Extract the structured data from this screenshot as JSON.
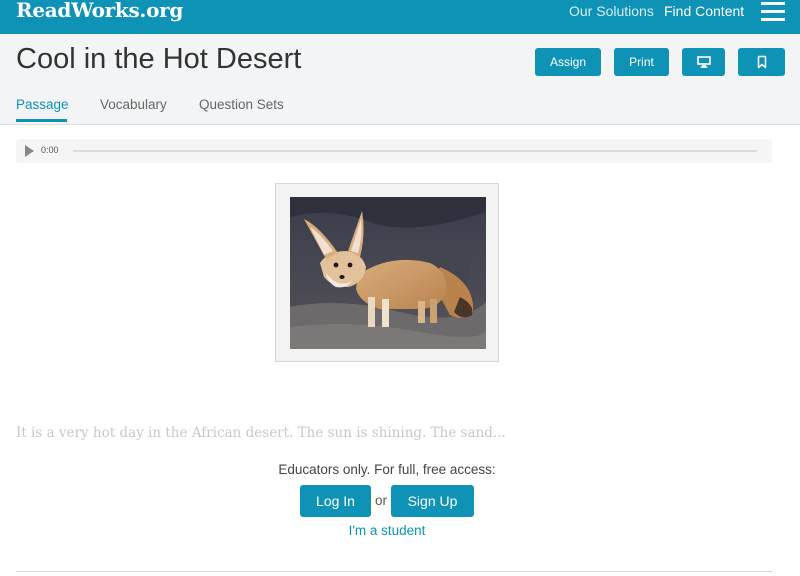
{
  "nav": {
    "logo": "ReadWorks.org",
    "our_solutions": "Our Solutions",
    "find_content": "Find Content",
    "menu_icon": "hamburger-icon"
  },
  "header": {
    "title": "Cool in the Hot Desert",
    "assign_label": "Assign",
    "print_label": "Print",
    "monitor_icon": "monitor-icon",
    "bookmark_icon": "bookmark-icon",
    "tabs": [
      {
        "label": "Passage",
        "active": true
      },
      {
        "label": "Vocabulary",
        "active": false
      },
      {
        "label": "Question Sets",
        "active": false
      }
    ]
  },
  "audio": {
    "time": "0:00",
    "progress": 0
  },
  "passage": {
    "image_icon": "fennec-fox-photo",
    "preview_text": "It is a very hot day in the African desert. The sun is shining. The sand..."
  },
  "access": {
    "message": "Educators only. For full, free access:",
    "login_label": "Log In",
    "or_text": "or",
    "signup_label": "Sign Up",
    "student_link": "I'm a student"
  },
  "colors": {
    "brand": "#0e93b6",
    "header_bg": "#f3f4f5"
  }
}
